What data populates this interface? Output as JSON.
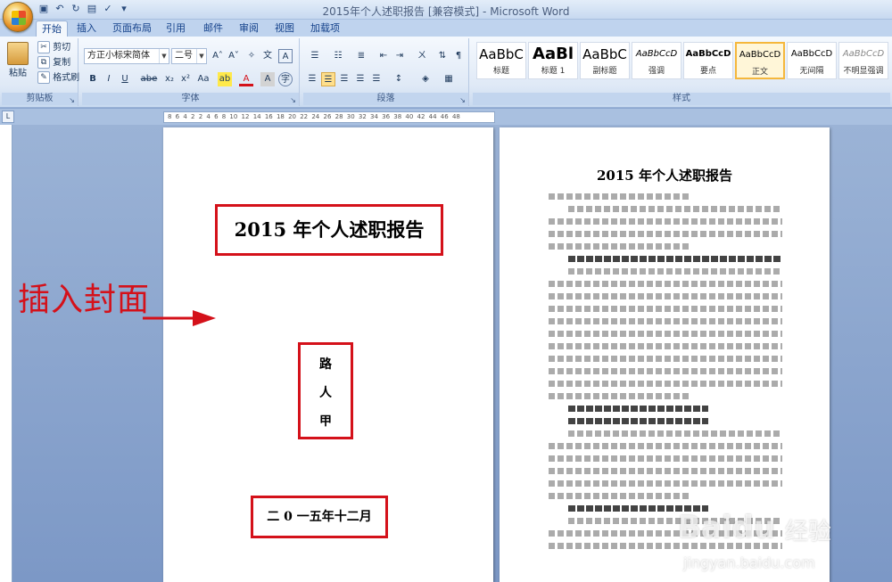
{
  "window": {
    "title": "2015年个人述职报告 [兼容模式] - Microsoft Word"
  },
  "tabs": [
    "开始",
    "插入",
    "页面布局",
    "引用",
    "邮件",
    "审阅",
    "视图",
    "加载项"
  ],
  "ribbon": {
    "clipboard": {
      "label": "剪贴板",
      "paste": "粘贴",
      "cut": "剪切",
      "copy": "复制",
      "format_painter": "格式刷"
    },
    "font": {
      "label": "字体",
      "font_name": "方正小标宋简体",
      "font_size": "二号",
      "buttons": [
        "B",
        "I",
        "U",
        "abe",
        "x₂",
        "x²",
        "Aa"
      ]
    },
    "paragraph": {
      "label": "段落"
    },
    "styles": {
      "label": "样式",
      "items": [
        {
          "preview": "AaBbC",
          "name": "标题"
        },
        {
          "preview": "AaBl",
          "name": "标题 1"
        },
        {
          "preview": "AaBbC",
          "name": "副标题"
        },
        {
          "preview": "AaBbCcD",
          "name": "强调"
        },
        {
          "preview": "AaBbCcD",
          "name": "要点"
        },
        {
          "preview": "AaBbCcD",
          "name": "正文"
        },
        {
          "preview": "AaBbCcD",
          "name": "无间隔"
        },
        {
          "preview": "AaBbCcD",
          "name": "不明显强调"
        }
      ],
      "selected_index": 5
    }
  },
  "ruler": {
    "ticks": "8 6 4 2 2 4 6 8 10 12 14 16 18 20 22 24 26 28 30 32 34 36 38 40 42 44 46 48"
  },
  "page1": {
    "title": "2015 年个人述职报告",
    "author_chars": [
      "路",
      "人",
      "甲"
    ],
    "date": "二 0 一五年十二月"
  },
  "page2": {
    "title": "2015 年个人述职报告"
  },
  "annotation": {
    "text": "插入封面",
    "color": "#d4111a"
  },
  "watermark": {
    "brand": "Baidu",
    "jingyan": "经验",
    "url": "jingyan.baidu.com"
  }
}
